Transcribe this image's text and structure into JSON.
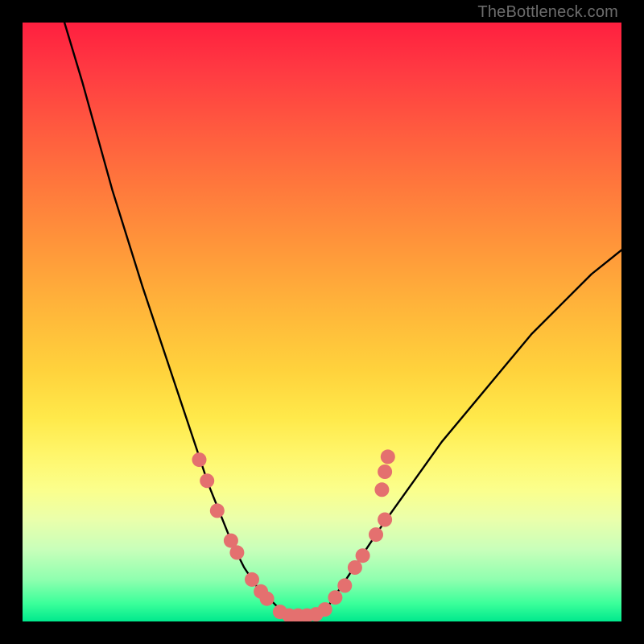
{
  "watermark": "TheBottleneck.com",
  "colors": {
    "frame": "#000000",
    "curve_stroke": "#000000",
    "marker_fill": "#E4706F",
    "marker_stroke": "#D55B5A",
    "gradient_top": "#ff1f3f",
    "gradient_bottom": "#00e98d"
  },
  "chart_data": {
    "type": "line",
    "title": "",
    "xlabel": "",
    "ylabel": "",
    "xlim": [
      0,
      100
    ],
    "ylim": [
      0,
      100
    ],
    "grid": false,
    "legend": false,
    "series": [
      {
        "name": "bottleneck-curve",
        "x": [
          7,
          10,
          15,
          20,
          25,
          27,
          29,
          31,
          33,
          35,
          37,
          39,
          40,
          41,
          42,
          43,
          44,
          45,
          46,
          47,
          48,
          49,
          50,
          51,
          52,
          53,
          55,
          57,
          60,
          65,
          70,
          75,
          80,
          85,
          90,
          95,
          100
        ],
        "y": [
          100,
          90,
          72,
          56,
          41,
          35,
          29,
          23,
          18,
          13,
          9,
          6,
          5,
          4,
          3,
          2,
          1.4,
          1,
          1,
          1,
          1,
          1,
          1.5,
          2.5,
          4,
          5.5,
          8.5,
          11.5,
          16,
          23,
          30,
          36,
          42,
          48,
          53,
          58,
          62
        ]
      }
    ],
    "markers": {
      "name": "highlighted-points",
      "points": [
        {
          "x": 29.5,
          "y": 27
        },
        {
          "x": 30.8,
          "y": 23.5
        },
        {
          "x": 32.5,
          "y": 18.5
        },
        {
          "x": 34.8,
          "y": 13.5
        },
        {
          "x": 35.8,
          "y": 11.5
        },
        {
          "x": 38.3,
          "y": 7
        },
        {
          "x": 39.8,
          "y": 5
        },
        {
          "x": 40.8,
          "y": 3.8
        },
        {
          "x": 43.0,
          "y": 1.6
        },
        {
          "x": 44.5,
          "y": 1.0
        },
        {
          "x": 46.0,
          "y": 1.0
        },
        {
          "x": 47.5,
          "y": 1.0
        },
        {
          "x": 49.0,
          "y": 1.2
        },
        {
          "x": 50.5,
          "y": 2.0
        },
        {
          "x": 52.2,
          "y": 4.0
        },
        {
          "x": 53.8,
          "y": 6.0
        },
        {
          "x": 55.5,
          "y": 9.0
        },
        {
          "x": 56.8,
          "y": 11.0
        },
        {
          "x": 59.0,
          "y": 14.5
        },
        {
          "x": 60.5,
          "y": 17.0
        },
        {
          "x": 60.0,
          "y": 22.0
        },
        {
          "x": 60.5,
          "y": 25.0
        },
        {
          "x": 61.0,
          "y": 27.5
        }
      ]
    }
  }
}
